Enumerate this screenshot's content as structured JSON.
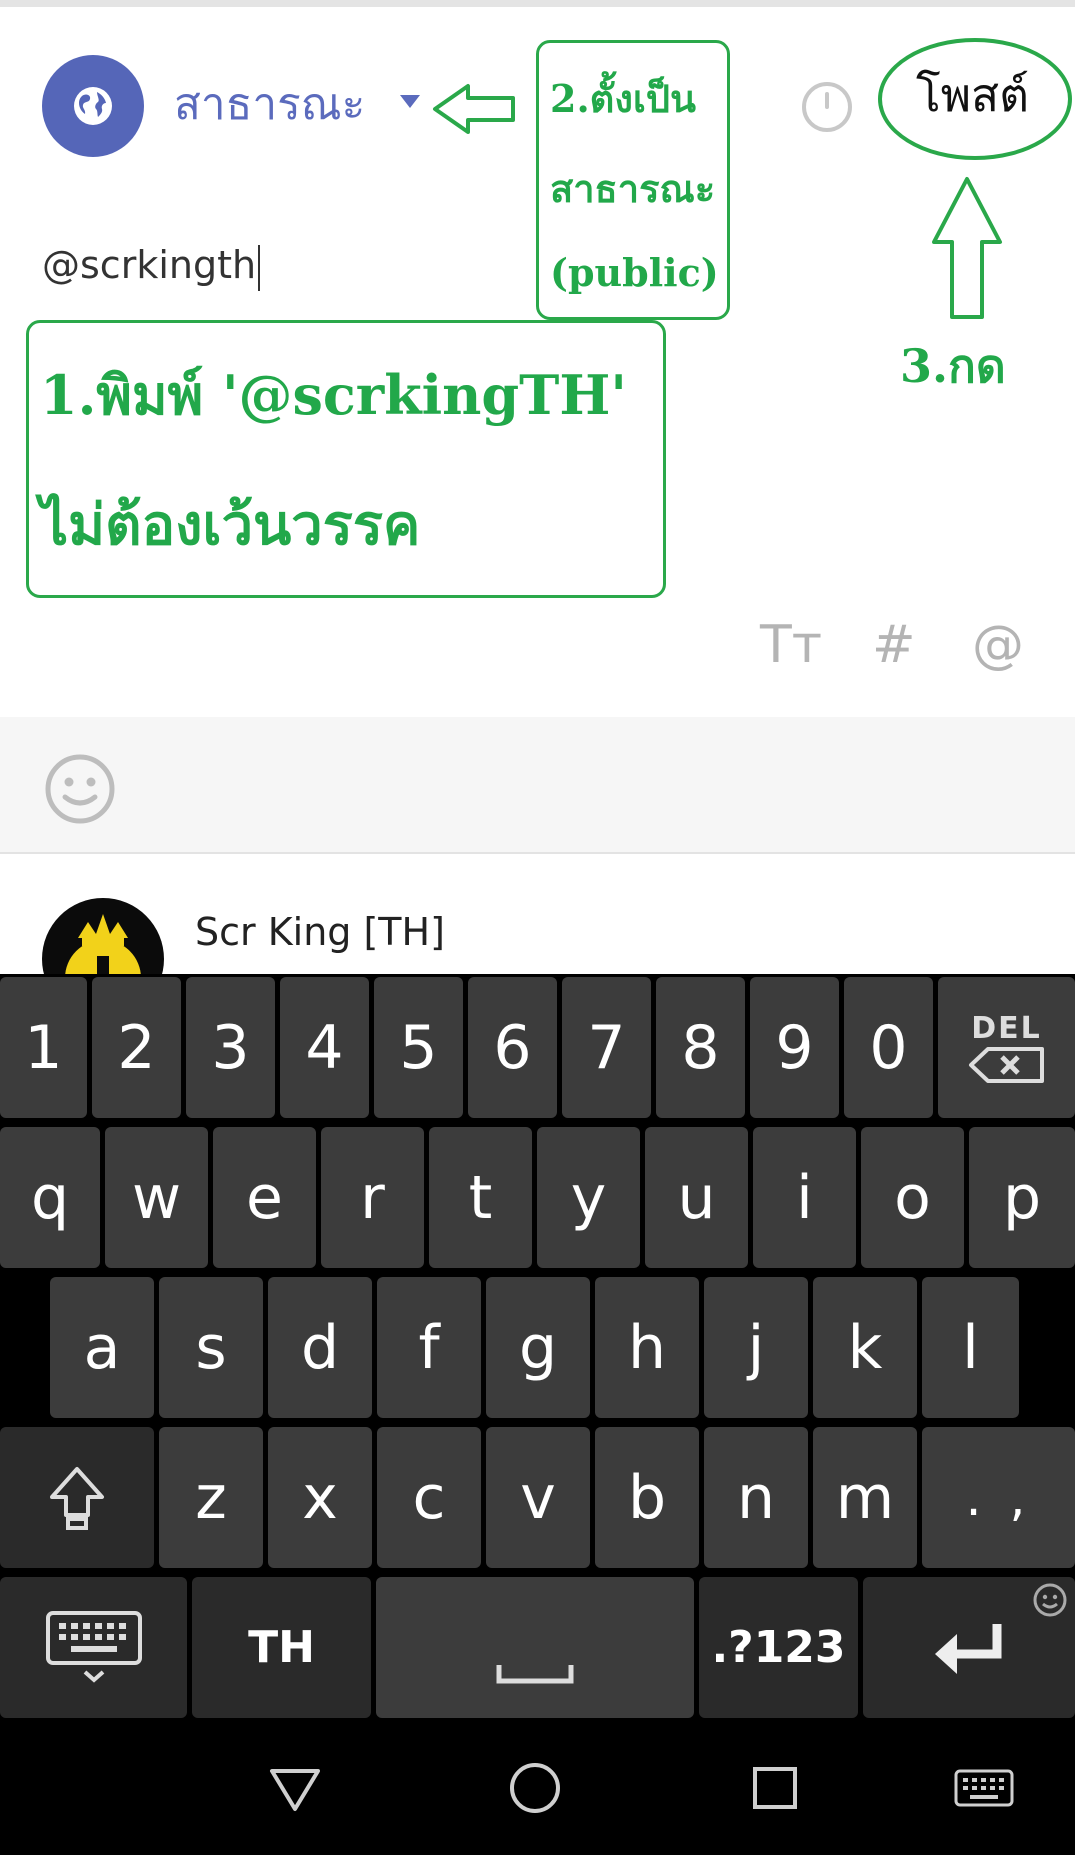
{
  "header": {
    "privacy_label": "สาธารณะ",
    "post_button_label": "โพสต์",
    "icons": {
      "globe": "globe-icon",
      "clock": "clock-icon",
      "dropdown": "caret-down-icon"
    }
  },
  "composer": {
    "text": "@scrkingth"
  },
  "annotations": {
    "step1_line1": "1.พิมพ์ '@scrkingTH'",
    "step1_line2": "ไม่ต้องเว้นวรรค",
    "step2_line1": "2.ตั้งเป็น",
    "step2_line2": "สาธารณะ",
    "step2_line3": "(public)",
    "step3": "3.กด",
    "color": "#22a84a"
  },
  "format_toolbar": {
    "text_size": "Tт",
    "hashtag": "#",
    "mention": "@"
  },
  "suggestion": {
    "name": "Scr King [TH]"
  },
  "keyboard": {
    "numbers": [
      "1",
      "2",
      "3",
      "4",
      "5",
      "6",
      "7",
      "8",
      "9",
      "0"
    ],
    "del_label": "DEL",
    "row1": [
      "q",
      "w",
      "e",
      "r",
      "t",
      "y",
      "u",
      "i",
      "o",
      "p"
    ],
    "row2": [
      "a",
      "s",
      "d",
      "f",
      "g",
      "h",
      "j",
      "k",
      "l"
    ],
    "row3": [
      "z",
      "x",
      "c",
      "v",
      "b",
      "n",
      "m"
    ],
    "punct": ". ,",
    "lang": "TH",
    "symbols": ".?123"
  }
}
